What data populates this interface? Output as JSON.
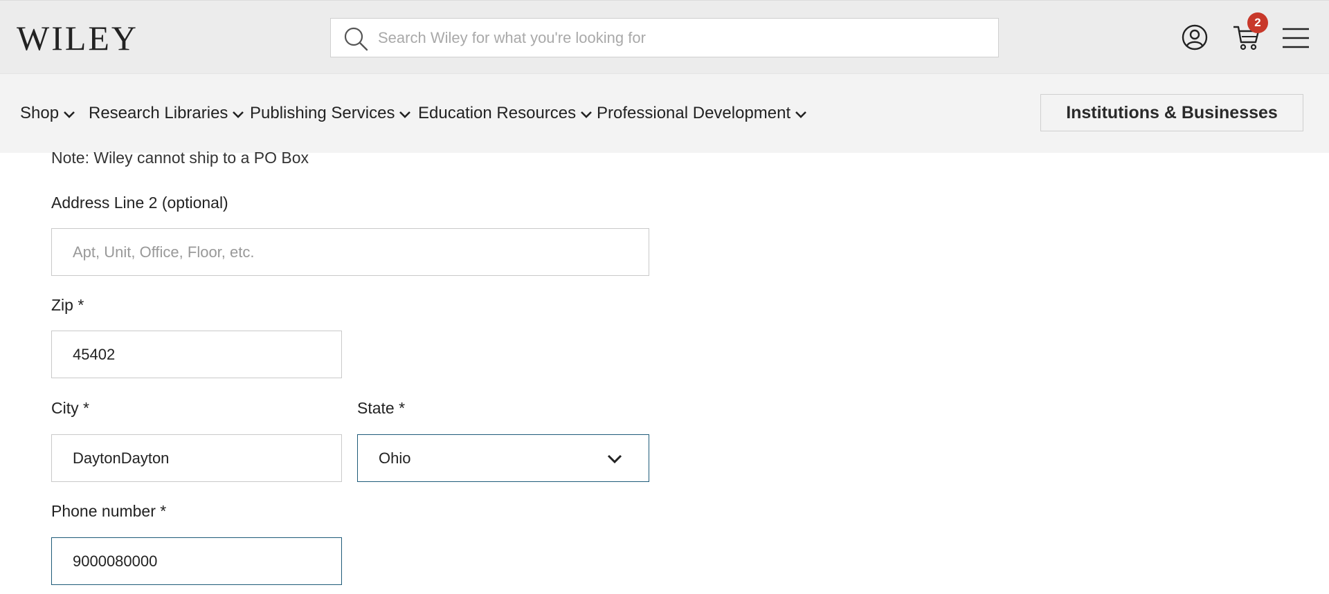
{
  "header": {
    "logo": "WILEY",
    "search": {
      "placeholder": "Search Wiley for what you're looking for",
      "value": ""
    },
    "cart": {
      "count": "2"
    },
    "icons": [
      "account-icon",
      "cart-icon",
      "menu-icon",
      "search-icon"
    ]
  },
  "nav": {
    "items": [
      {
        "label": "Shop"
      },
      {
        "label": "Research Libraries"
      },
      {
        "label": "Publishing Services"
      },
      {
        "label": "Education Resources"
      },
      {
        "label": "Professional Development"
      }
    ],
    "institutions_button": "Institutions & Businesses"
  },
  "form": {
    "note": "Note: Wiley cannot ship to a PO Box",
    "address2": {
      "label": "Address Line 2 (optional)",
      "placeholder": "Apt, Unit, Office, Floor, etc.",
      "value": ""
    },
    "zip": {
      "label": "Zip *",
      "value": "45402"
    },
    "city": {
      "label": "City *",
      "value": "DaytonDayton"
    },
    "state": {
      "label": "State *",
      "value": "Ohio"
    },
    "phone": {
      "label": "Phone number *",
      "value": "9000080000"
    }
  },
  "colors": {
    "focus_border": "#1d5a78",
    "badge": "#c8382a",
    "header_bg": "#ececec",
    "nav_bg": "#f3f3f3"
  }
}
